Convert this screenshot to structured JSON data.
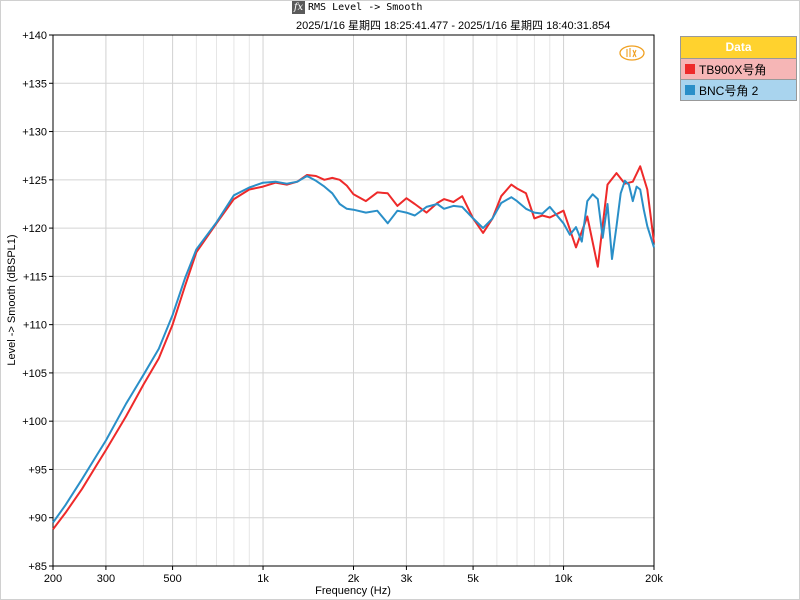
{
  "window": {
    "title": "RMS Level -> Smooth",
    "icon": "fx-icon"
  },
  "subtitle": "2025/1/16 星期四 18:25:41.477 - 2025/1/16 星期四 18:40:31.854",
  "legend": {
    "header": "Data",
    "header_color": "#ffd22e",
    "items": [
      {
        "label": "TB900X号角",
        "color": "#ee2a2a",
        "row_bg": "#f6b6b6"
      },
      {
        "label": "BNC号角 2",
        "color": "#2a8fc8",
        "row_bg": "#a9d4ee"
      }
    ]
  },
  "chart_data": {
    "type": "line",
    "xscale": "log",
    "xlabel": "Frequency (Hz)",
    "ylabel": "Level -> Smooth (dBSPL1)",
    "xlim": [
      200,
      20000
    ],
    "ylim": [
      85,
      140
    ],
    "xticks": [
      {
        "value": 200,
        "label": "200"
      },
      {
        "value": 300,
        "label": "300"
      },
      {
        "value": 500,
        "label": "500"
      },
      {
        "value": 1000,
        "label": "1k"
      },
      {
        "value": 2000,
        "label": "2k"
      },
      {
        "value": 3000,
        "label": "3k"
      },
      {
        "value": 5000,
        "label": "5k"
      },
      {
        "value": 10000,
        "label": "10k"
      },
      {
        "value": 20000,
        "label": "20k"
      }
    ],
    "yticks": [
      {
        "value": 85,
        "label": "+85"
      },
      {
        "value": 90,
        "label": "+90"
      },
      {
        "value": 95,
        "label": "+95"
      },
      {
        "value": 100,
        "label": "+100"
      },
      {
        "value": 105,
        "label": "+105"
      },
      {
        "value": 110,
        "label": "+110"
      },
      {
        "value": 115,
        "label": "+115"
      },
      {
        "value": 120,
        "label": "+120"
      },
      {
        "value": 125,
        "label": "+125"
      },
      {
        "value": 130,
        "label": "+130"
      },
      {
        "value": 135,
        "label": "+135"
      },
      {
        "value": 140,
        "label": "+140"
      }
    ],
    "grid": true,
    "series": [
      {
        "name": "TB900X号角",
        "color": "#ee2a2a",
        "x": [
          200,
          220,
          250,
          280,
          300,
          350,
          400,
          450,
          500,
          550,
          600,
          700,
          800,
          900,
          1000,
          1100,
          1200,
          1300,
          1400,
          1500,
          1600,
          1700,
          1800,
          1900,
          2000,
          2200,
          2400,
          2600,
          2800,
          3000,
          3200,
          3500,
          3800,
          4000,
          4300,
          4600,
          5000,
          5400,
          5800,
          6200,
          6700,
          7000,
          7500,
          8000,
          8500,
          9000,
          10000,
          11000,
          12000,
          13000,
          14000,
          15000,
          16000,
          17000,
          18000,
          19000,
          20000
        ],
        "y": [
          88.8,
          90.5,
          93.0,
          95.5,
          97.0,
          100.5,
          103.8,
          106.5,
          110.0,
          114.0,
          117.5,
          120.5,
          123.0,
          124.0,
          124.3,
          124.7,
          124.5,
          124.8,
          125.5,
          125.4,
          125.0,
          125.2,
          125.0,
          124.4,
          123.5,
          122.8,
          123.7,
          123.6,
          122.3,
          123.1,
          122.5,
          121.6,
          122.6,
          123.0,
          122.7,
          123.3,
          121.0,
          119.5,
          121.0,
          123.3,
          124.5,
          124.1,
          123.6,
          121.0,
          121.3,
          121.1,
          121.8,
          118.0,
          121.2,
          116.0,
          124.5,
          125.7,
          124.6,
          124.8,
          126.4,
          124.0,
          118.5
        ]
      },
      {
        "name": "BNC号角 2",
        "color": "#2a8fc8",
        "x": [
          200,
          220,
          250,
          280,
          300,
          350,
          400,
          450,
          500,
          550,
          600,
          700,
          800,
          900,
          1000,
          1100,
          1200,
          1300,
          1400,
          1500,
          1600,
          1700,
          1800,
          1900,
          2000,
          2200,
          2400,
          2600,
          2800,
          3000,
          3200,
          3500,
          3800,
          4000,
          4300,
          4600,
          5000,
          5400,
          5800,
          6200,
          6700,
          7000,
          7500,
          8000,
          8500,
          9000,
          10000,
          10500,
          11000,
          11500,
          12000,
          12500,
          13000,
          13500,
          14000,
          14500,
          15000,
          15500,
          16000,
          16500,
          17000,
          17500,
          18000,
          18500,
          19000,
          20000
        ],
        "y": [
          89.5,
          91.3,
          94.0,
          96.5,
          98.0,
          101.8,
          104.8,
          107.5,
          111.0,
          114.8,
          117.8,
          120.6,
          123.4,
          124.2,
          124.7,
          124.8,
          124.6,
          124.8,
          125.4,
          124.9,
          124.3,
          123.6,
          122.5,
          122.0,
          121.9,
          121.6,
          121.8,
          120.5,
          121.8,
          121.6,
          121.3,
          122.2,
          122.5,
          122.0,
          122.3,
          122.2,
          121.0,
          120.0,
          121.0,
          122.6,
          123.2,
          122.8,
          122.0,
          121.6,
          121.5,
          122.2,
          120.5,
          119.3,
          120.1,
          118.6,
          122.8,
          123.5,
          123.0,
          119.0,
          122.5,
          116.8,
          120.2,
          123.6,
          124.9,
          124.5,
          122.8,
          124.3,
          124.0,
          121.9,
          120.2,
          118.0
        ]
      }
    ]
  }
}
